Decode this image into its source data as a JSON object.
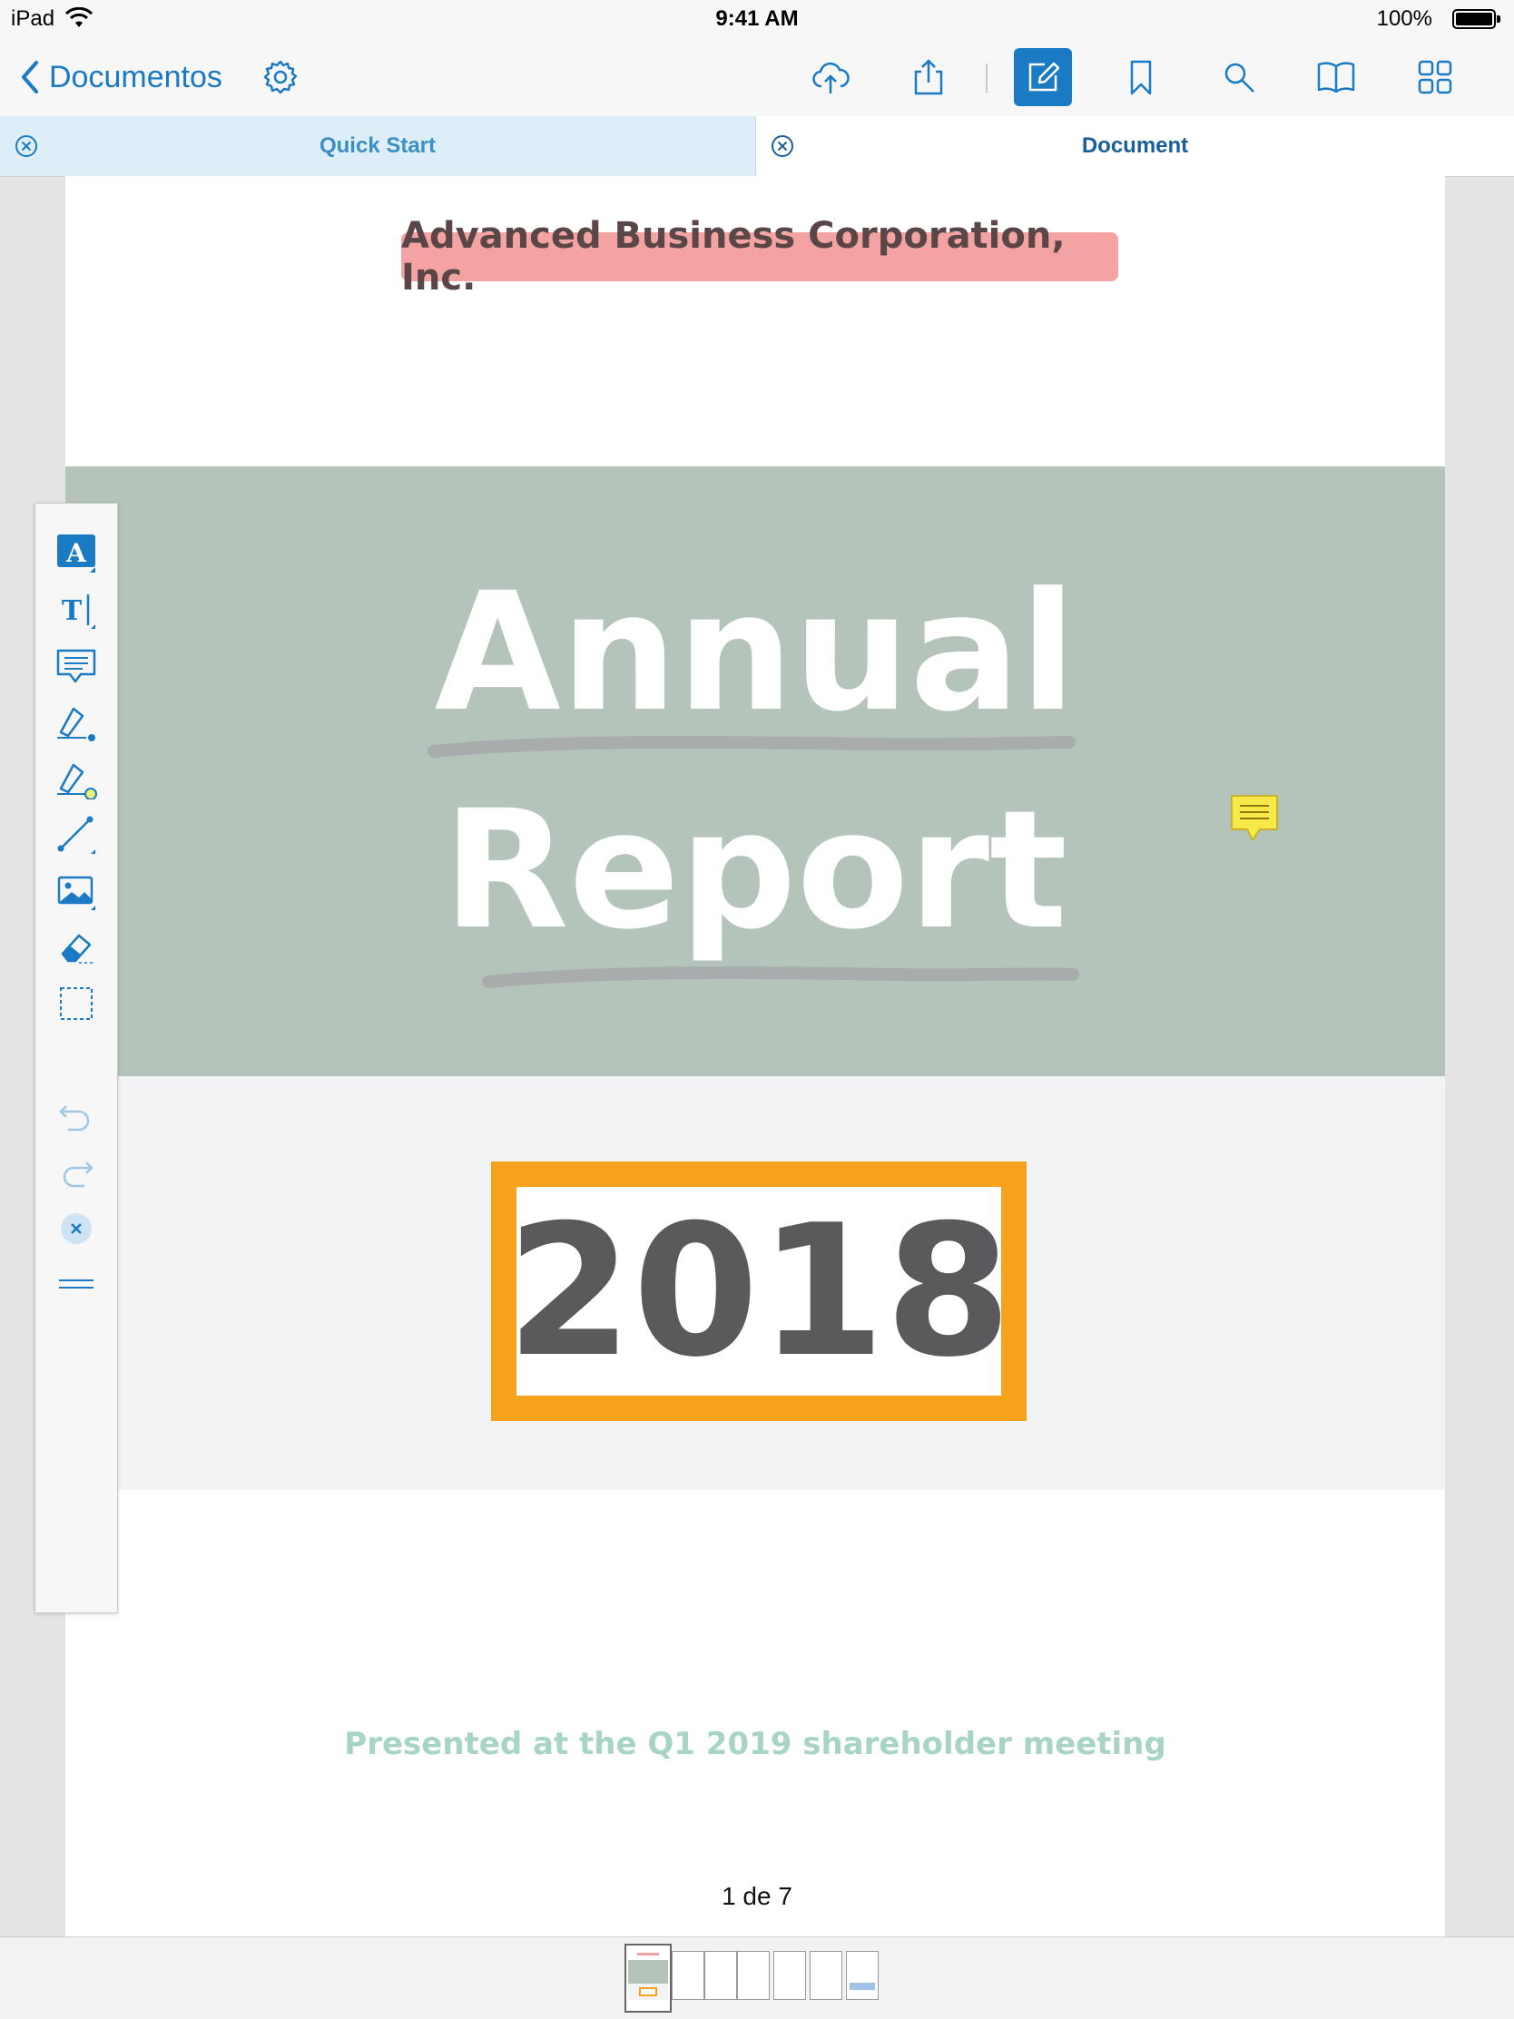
{
  "status_bar": {
    "device": "iPad",
    "time": "9:41 AM",
    "battery": "100%"
  },
  "nav": {
    "back_label": "Documentos",
    "icons": [
      "gear-icon",
      "cloud-upload-icon",
      "share-icon",
      "annotate-icon",
      "bookmark-icon",
      "search-icon",
      "book-icon",
      "grid-icon"
    ],
    "accent": "#1a7ac4"
  },
  "tabs": [
    {
      "label": "Quick Start"
    },
    {
      "label": "Document"
    }
  ],
  "document": {
    "company": "Advanced Business Corporation, Inc.",
    "title_line1": "Annual",
    "title_line2": "Report",
    "year": "2018",
    "subtitle": "Presented at the Q1 2019 shareholder meeting",
    "page_indicator": "1 de 7",
    "colors": {
      "highlight": "#f4a3a3",
      "band": "#b4c4ba",
      "year_border": "#f7a21c",
      "subtitle": "#a8d4c5"
    }
  },
  "toolbar": {
    "tools": [
      "highlight-text-icon",
      "text-box-icon",
      "comment-icon",
      "freehand-pen-icon",
      "highlighter-pen-icon",
      "line-icon",
      "image-icon",
      "eraser-icon",
      "selection-icon",
      "undo-icon",
      "redo-icon",
      "close-icon",
      "menu-icon"
    ]
  },
  "thumbnails": {
    "count": 7,
    "selected": 1
  }
}
